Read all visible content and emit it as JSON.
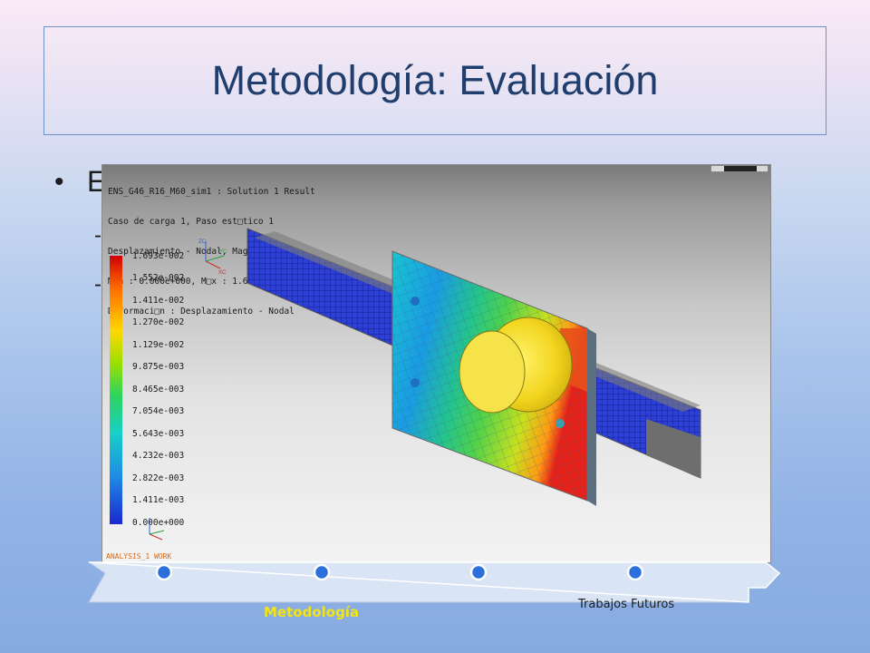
{
  "slide": {
    "title": "Metodología: Evaluación",
    "bullet_char": "•",
    "bullet_text": "E",
    "sub_dash": "-"
  },
  "simulation": {
    "header_lines": [
      "ENS_G46_R16_M60_sim1 : Solution 1 Result",
      "Caso de carga 1, Paso est\u0000tico 1",
      "Desplazamiento - Nodal, Magnitud",
      "M\u0000n : 0.000e+000, M\u0000x : 1.693e-002, mm",
      "Deformaci\u0000n : Desplazamiento - Nodal"
    ],
    "colorbar_labels": [
      "1.693e-002",
      "1.552e-002",
      "1.411e-002",
      "1.270e-002",
      "1.129e-002",
      "9.875e-003",
      "8.465e-003",
      "7.054e-003",
      "5.643e-003",
      "4.232e-003",
      "2.822e-003",
      "1.411e-003",
      "0.000e+000"
    ],
    "footer_label": "ANALYSIS_1 WORK",
    "triad_labels": {
      "z": "ZC",
      "y": "YC",
      "x": "XC"
    }
  },
  "timeline": {
    "steps": [
      "",
      "Metodología",
      "",
      "Trabajos Futuros"
    ],
    "active_label": "Metodología",
    "future_label": "Trabajos Futuros"
  },
  "colors": {
    "title": "#1f3e6e",
    "active_step": "#f3e514",
    "timeline_fill": "#d9e4f5",
    "dot": "#2a6fdc"
  }
}
